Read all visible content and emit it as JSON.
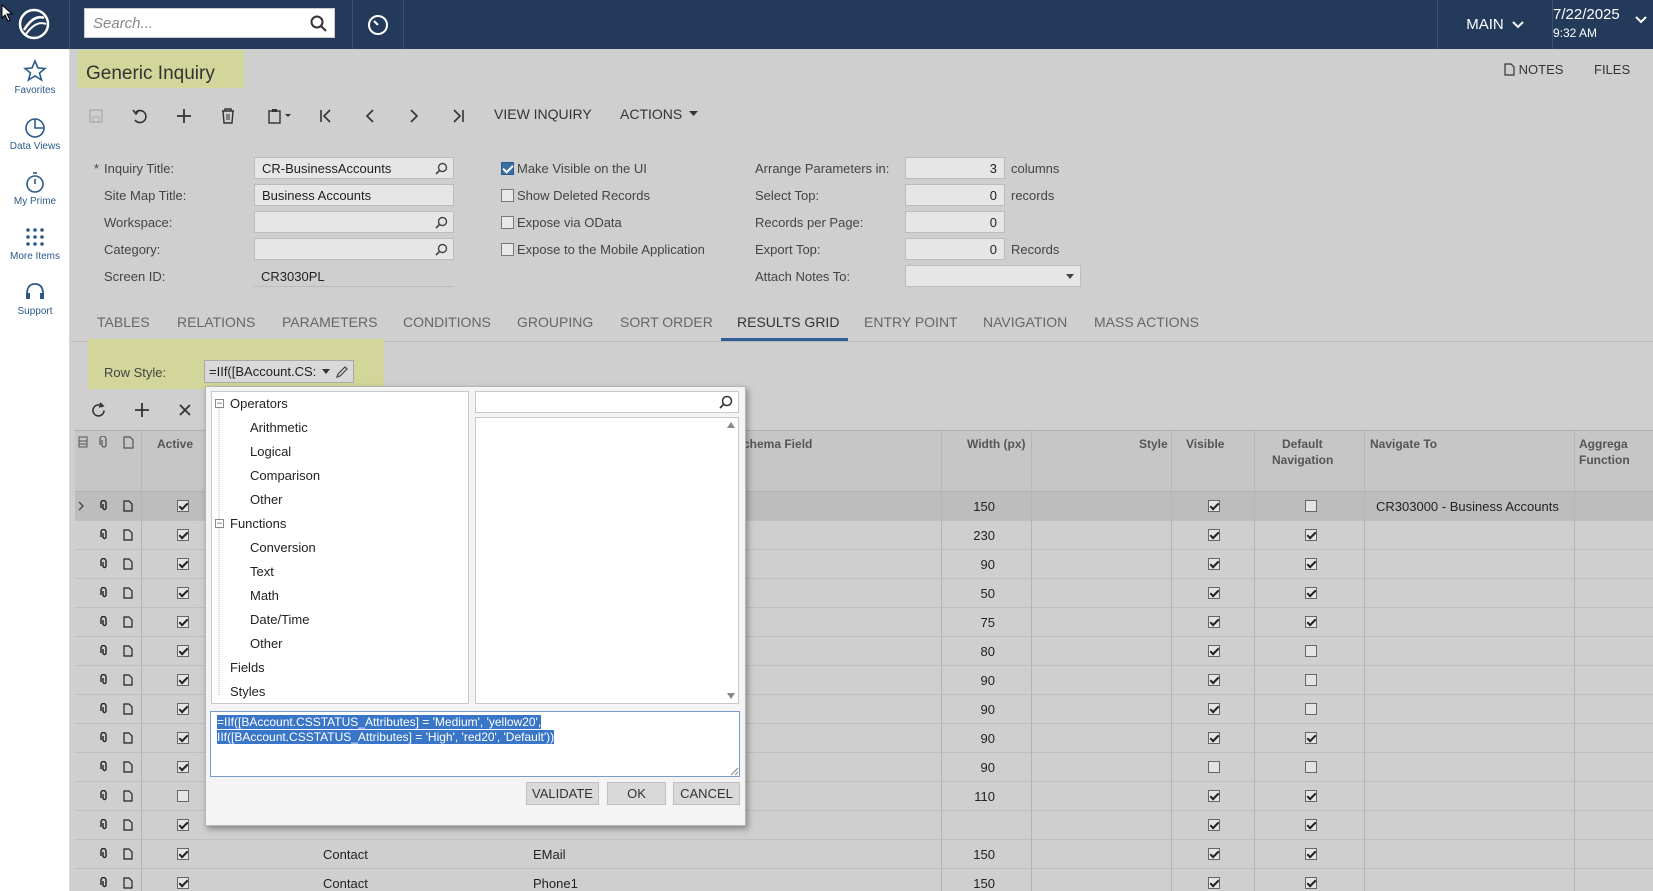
{
  "topbar": {
    "search_placeholder": "Search...",
    "branch": "MAIN",
    "date": "7/22/2025",
    "time": "9:32 AM"
  },
  "sidebar": {
    "items": [
      {
        "label": "Favorites",
        "icon": "star-icon"
      },
      {
        "label": "Data Views",
        "icon": "pie-chart-icon"
      },
      {
        "label": "My Prime",
        "icon": "stopwatch-icon"
      },
      {
        "label": "More Items",
        "icon": "grid-dots-icon"
      },
      {
        "label": "Support",
        "icon": "headset-icon"
      }
    ]
  },
  "page": {
    "title": "Generic Inquiry",
    "notes": "NOTES",
    "files": "FILES"
  },
  "toolbar": {
    "view_inquiry": "VIEW INQUIRY",
    "actions": "ACTIONS"
  },
  "form": {
    "inquiry_title_label": "Inquiry Title:",
    "inquiry_title_value": "CR-BusinessAccounts",
    "site_map_title_label": "Site Map Title:",
    "site_map_title_value": "Business Accounts",
    "workspace_label": "Workspace:",
    "workspace_value": "",
    "category_label": "Category:",
    "category_value": "",
    "screen_id_label": "Screen ID:",
    "screen_id_value": "CR3030PL",
    "make_visible": "Make Visible on the UI",
    "show_deleted": "Show Deleted Records",
    "expose_odata": "Expose via OData",
    "expose_mobile": "Expose to the Mobile Application",
    "arrange_label": "Arrange Parameters in:",
    "arrange_value": "3",
    "arrange_unit": "columns",
    "select_top_label": "Select Top:",
    "select_top_value": "0",
    "select_top_unit": "records",
    "records_per_page_label": "Records per Page:",
    "records_per_page_value": "0",
    "export_top_label": "Export Top:",
    "export_top_value": "0",
    "export_top_unit": "Records",
    "attach_notes_label": "Attach Notes To:",
    "attach_notes_value": ""
  },
  "tabs": [
    "TABLES",
    "RELATIONS",
    "PARAMETERS",
    "CONDITIONS",
    "GROUPING",
    "SORT ORDER",
    "RESULTS GRID",
    "ENTRY POINT",
    "NAVIGATION",
    "MASS ACTIONS"
  ],
  "row_style": {
    "label": "Row Style:",
    "value": "=IIf([BAccount.CS:"
  },
  "grid": {
    "headers": {
      "active": "Active",
      "schema_field": "chema Field",
      "width": "Width (px)",
      "style": "Style",
      "visible": "Visible",
      "default_nav": [
        "Default",
        "Navigation"
      ],
      "navigate_to": "Navigate To",
      "aggregate": [
        "Aggrega",
        "Function"
      ]
    },
    "rows": [
      {
        "active": true,
        "object": "",
        "field": "",
        "width": "150",
        "visible": true,
        "defnav": false,
        "navigate": "CR303000 - Business Accounts",
        "selected": true
      },
      {
        "active": true,
        "object": "",
        "field": "",
        "width": "230",
        "visible": true,
        "defnav": true,
        "navigate": ""
      },
      {
        "active": true,
        "object": "",
        "field": "",
        "width": "90",
        "visible": true,
        "defnav": true,
        "navigate": ""
      },
      {
        "active": true,
        "object": "",
        "field": "",
        "width": "50",
        "visible": true,
        "defnav": true,
        "navigate": ""
      },
      {
        "active": true,
        "object": "",
        "field": "",
        "width": "75",
        "visible": true,
        "defnav": true,
        "navigate": ""
      },
      {
        "active": true,
        "object": "",
        "field": "",
        "width": "80",
        "visible": true,
        "defnav": false,
        "navigate": ""
      },
      {
        "active": true,
        "object": "",
        "field": "",
        "width": "90",
        "visible": true,
        "defnav": false,
        "navigate": ""
      },
      {
        "active": true,
        "object": "",
        "field": "",
        "width": "90",
        "visible": true,
        "defnav": false,
        "navigate": ""
      },
      {
        "active": true,
        "object": "",
        "field": "",
        "width": "90",
        "visible": true,
        "defnav": true,
        "navigate": ""
      },
      {
        "active": true,
        "object": "",
        "field": "",
        "width": "90",
        "visible": false,
        "defnav": false,
        "navigate": ""
      },
      {
        "active": false,
        "object": "",
        "field": "",
        "width": "110",
        "visible": true,
        "defnav": true,
        "navigate": ""
      },
      {
        "active": true,
        "object": "",
        "field": "",
        "width": "",
        "visible": true,
        "defnav": true,
        "navigate": ""
      },
      {
        "active": true,
        "object": "Contact",
        "field": "EMail",
        "width": "150",
        "visible": true,
        "defnav": true,
        "navigate": ""
      },
      {
        "active": true,
        "object": "Contact",
        "field": "Phone1",
        "width": "150",
        "visible": true,
        "defnav": true,
        "navigate": ""
      }
    ]
  },
  "dialog": {
    "tree": [
      {
        "label": "Operators",
        "level": 0,
        "expanded": true
      },
      {
        "label": "Arithmetic",
        "level": 1
      },
      {
        "label": "Logical",
        "level": 1
      },
      {
        "label": "Comparison",
        "level": 1
      },
      {
        "label": "Other",
        "level": 1
      },
      {
        "label": "Functions",
        "level": 0,
        "expanded": true
      },
      {
        "label": "Conversion",
        "level": 1
      },
      {
        "label": "Text",
        "level": 1
      },
      {
        "label": "Math",
        "level": 1
      },
      {
        "label": "Date/Time",
        "level": 1
      },
      {
        "label": "Other",
        "level": 1
      },
      {
        "label": "Fields",
        "level": 0
      },
      {
        "label": "Styles",
        "level": 0
      }
    ],
    "expression_line1": "=IIf([BAccount.CSSTATUS_Attributes] = 'Medium', 'yellow20',",
    "expression_line2": "IIf([BAccount.CSSTATUS_Attributes] = 'High', 'red20', 'Default'))",
    "validate": "VALIDATE",
    "ok": "OK",
    "cancel": "CANCEL"
  }
}
